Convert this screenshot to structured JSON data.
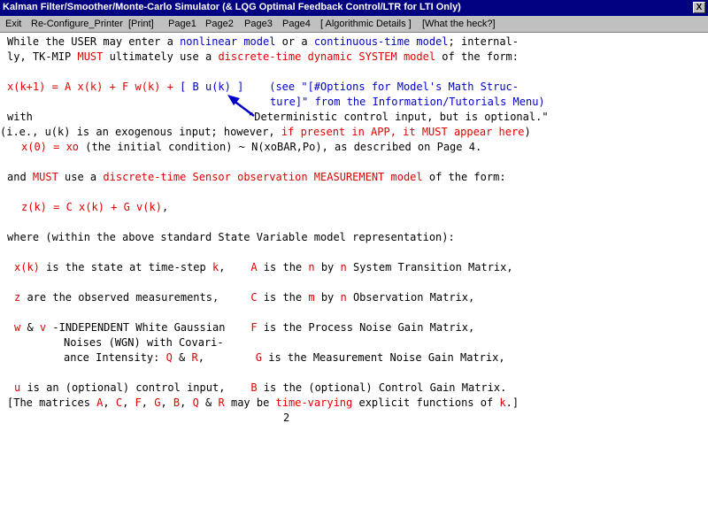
{
  "window": {
    "title": "Kalman Filter/Smoother/Monte-Carlo Simulator (& LQG Optimal Feedback Control/LTR for LTI Only)",
    "close_label": "X"
  },
  "menu": [
    "Exit",
    "Re-Configure_Printer",
    "[Print]",
    "Page1",
    "Page2",
    "Page3",
    "Page4",
    "[ Algorithmic Details ]",
    "[What the heck?]"
  ],
  "lines": [
    [
      [
        "k",
        "While the USER may enter a "
      ],
      [
        "b",
        "nonlinear model"
      ],
      [
        "k",
        " or a "
      ],
      [
        "b",
        "continuous-time model"
      ],
      [
        "k",
        "; internal-"
      ]
    ],
    [
      [
        "k",
        "ly, TK-MIP "
      ],
      [
        "r",
        "MUST"
      ],
      [
        "k",
        " ultimately use a "
      ],
      [
        "r",
        "discrete-time dynamic SYSTEM model"
      ],
      [
        "k",
        " of the form:"
      ]
    ],
    [
      [
        "r",
        "x(k+1) = A x(k) + F w(k) + "
      ],
      [
        "b",
        "[ B u(k) ]"
      ],
      [
        "k",
        "    "
      ],
      [
        "b",
        "(see \"[#Options for Model's Math Struc-"
      ]
    ],
    [
      [
        "b",
        "ture]\" from the Information/Tutorials Menu)"
      ]
    ],
    [
      [
        "k",
        "with"
      ]
    ],
    [
      [
        "k",
        "\"Deterministic control input, but is optional.\""
      ]
    ],
    [
      [
        "k",
        "(i.e., u(k) is an exogenous input; however, "
      ],
      [
        "r",
        "if present in APP, it MUST appear here"
      ],
      [
        "k",
        ")"
      ]
    ],
    [
      [
        "r",
        "x(0) = xo"
      ],
      [
        "k",
        " (the initial condition) ~ N(xoBAR,Po), as described on Page 4."
      ]
    ],
    [
      [
        "k",
        "and "
      ],
      [
        "r",
        "MUST"
      ],
      [
        "k",
        " use a "
      ],
      [
        "r",
        "discrete-time Sensor observation MEASUREMENT model"
      ],
      [
        "k",
        " of the form:"
      ]
    ],
    [
      [
        "r",
        "z(k) = C x(k) + G v(k)"
      ],
      [
        "k",
        ","
      ]
    ],
    [
      [
        "k",
        "where (within the above standard State Variable model representation):"
      ]
    ],
    [
      [
        "r",
        "x(k)"
      ],
      [
        "k",
        " is the state at time-step "
      ],
      [
        "r",
        "k"
      ],
      [
        "k",
        ",    "
      ],
      [
        "r",
        "A"
      ],
      [
        "k",
        " is the "
      ],
      [
        "r",
        "n"
      ],
      [
        "k",
        " by "
      ],
      [
        "r",
        "n"
      ],
      [
        "k",
        " System Transition Matrix,"
      ]
    ],
    [
      [
        "r",
        "z"
      ],
      [
        "k",
        " are the observed measurements,     "
      ],
      [
        "r",
        "C"
      ],
      [
        "k",
        " is the "
      ],
      [
        "r",
        "m"
      ],
      [
        "k",
        " by "
      ],
      [
        "r",
        "n"
      ],
      [
        "k",
        " Observation Matrix,"
      ]
    ],
    [
      [
        "r",
        "w"
      ],
      [
        "k",
        " & "
      ],
      [
        "r",
        "v"
      ],
      [
        "k",
        " -INDEPENDENT White Gaussian    "
      ],
      [
        "r",
        "F"
      ],
      [
        "k",
        " is the Process Noise Gain Matrix,"
      ]
    ],
    [
      [
        "k",
        "Noises (WGN) with Covari-"
      ]
    ],
    [
      [
        "k",
        "ance Intensity: "
      ],
      [
        "r",
        "Q"
      ],
      [
        "k",
        " & "
      ],
      [
        "r",
        "R"
      ],
      [
        "k",
        ",        "
      ],
      [
        "r",
        "G"
      ],
      [
        "k",
        " is the Measurement Noise Gain Matrix,"
      ]
    ],
    [
      [
        "r",
        "u"
      ],
      [
        "k",
        " is an (optional) control input,    "
      ],
      [
        "r",
        "B"
      ],
      [
        "k",
        " is the (optional) Control Gain Matrix."
      ]
    ],
    [
      [
        "k",
        "[The matrices "
      ],
      [
        "r",
        "A"
      ],
      [
        "k",
        ", "
      ],
      [
        "r",
        "C"
      ],
      [
        "k",
        ", "
      ],
      [
        "r",
        "F"
      ],
      [
        "k",
        ", "
      ],
      [
        "r",
        "G"
      ],
      [
        "k",
        ", "
      ],
      [
        "r",
        "B"
      ],
      [
        "k",
        ", "
      ],
      [
        "r",
        "Q"
      ],
      [
        "k",
        " & "
      ],
      [
        "r",
        "R"
      ],
      [
        "k",
        " may be "
      ],
      [
        "r",
        "time-varying"
      ],
      [
        "k",
        " explicit functions of "
      ],
      [
        "r",
        "k"
      ],
      [
        "k",
        ".]"
      ]
    ],
    [
      [
        "k",
        "2"
      ]
    ]
  ],
  "colors": {
    "title_bar": "#000080",
    "menu_bar": "#c0c0c0",
    "emphasis": "#e00000",
    "hyperlink": "#0000c8",
    "arrow": "#0000c8"
  },
  "icons": {
    "arrow": "pointer-arrow-icon"
  }
}
